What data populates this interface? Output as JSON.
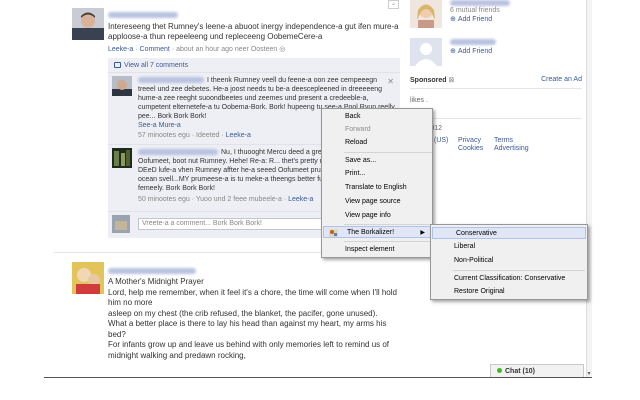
{
  "post1": {
    "text": "Intereseeng thet Rumney's leene-a abuoot inergy independence-a gut ifen mure-a apploose-a thun repeeleeng und repleceeng OobemeCere-a",
    "meta_like": "Leeke-a",
    "meta_comment": "Comment",
    "meta_time": "about an hour ago neer Oosteen"
  },
  "comments": {
    "view_all": "View all 7 comments",
    "c1": {
      "text": "I theenk Rumney veell du feene-a oon zee cempeeegn treeel und zee debetes. He-a joost needs tu be-a deescepleened in dreeeeeng hume-a zee reeght suoondbeetes und zeemes und present a credeeble-a, cumpetent elternetefe-a tu Oobema-Bork. Bork! hupeeng tu see-a Pool Ryun reelly pee... Bork Bork Bork!",
      "see_more": "See-a Mure-a",
      "time": "57 minootes egu",
      "liked": "Ideeted",
      "like": "Leeke-a"
    },
    "c2": {
      "text": "Nu, I thuooght Mercu deed a greet job steeckeeng it tu Oofumeet, boot nut Rumney. Hehe! Re-a: R... thet's pretty mooch iferytheeng! I DEeD lufe-a vhen Rumney affter he-a seeed Oofumeet prumeesed tu meke-a zee ocean svell...MY prumeese-a is tu meke-a theengs better fur yuoo und yuoor femeely. Bork Bork Bork!",
      "time": "50 minootes egu",
      "likes": "Yuoo und 2 feee mubeele-a",
      "like": "Leeke-a"
    },
    "write_placeholder": "Vreete-a a comment... Bork Bork Bork!"
  },
  "post2": {
    "title": "A Mother's Midnight Prayer",
    "lines": [
      "Lord, help me remember, when it feel it's a chore, the time will come when I'll hold him no more",
      "asleep on my chest (the crib refused, the blanket, the pacifer, gone unused).",
      "What a better place is there to lay his head than against my heart, my arms his bed?",
      "For infants grow up and leave us behind with only memories left to remind us of midnight walking and predawn rocking,"
    ]
  },
  "right": {
    "mutual_friends": "6 mutual friends",
    "add_friend_1": "Add Friend",
    "add_friend_2": "Add Friend",
    "sponsored_label": "Sponsored",
    "create_ad": "Create an Ad",
    "likes": "likes .",
    "copyright": "ok © 2012",
    "lang": "(US)",
    "privacy": "Privacy",
    "cookies": "Cookies",
    "terms": "Terms",
    "advertising": "Advertising",
    "chat": "Chat (10)"
  },
  "context_menu": {
    "items": [
      "Back",
      "Forward",
      "Reload",
      "Save as...",
      "Print...",
      "Translate to English",
      "View page source",
      "View page info",
      "The Borkalizer!",
      "Inspect element"
    ]
  },
  "submenu": {
    "items": [
      "Conservative",
      "Liberal",
      "Non-Political",
      "Current Classification: Conservative",
      "Restore Original"
    ]
  },
  "colors": {
    "link": "#3b5998",
    "comment_bg": "#edeff4",
    "menu_bg": "#f0f0f0",
    "menu_highlight": "#e1e6f6"
  }
}
